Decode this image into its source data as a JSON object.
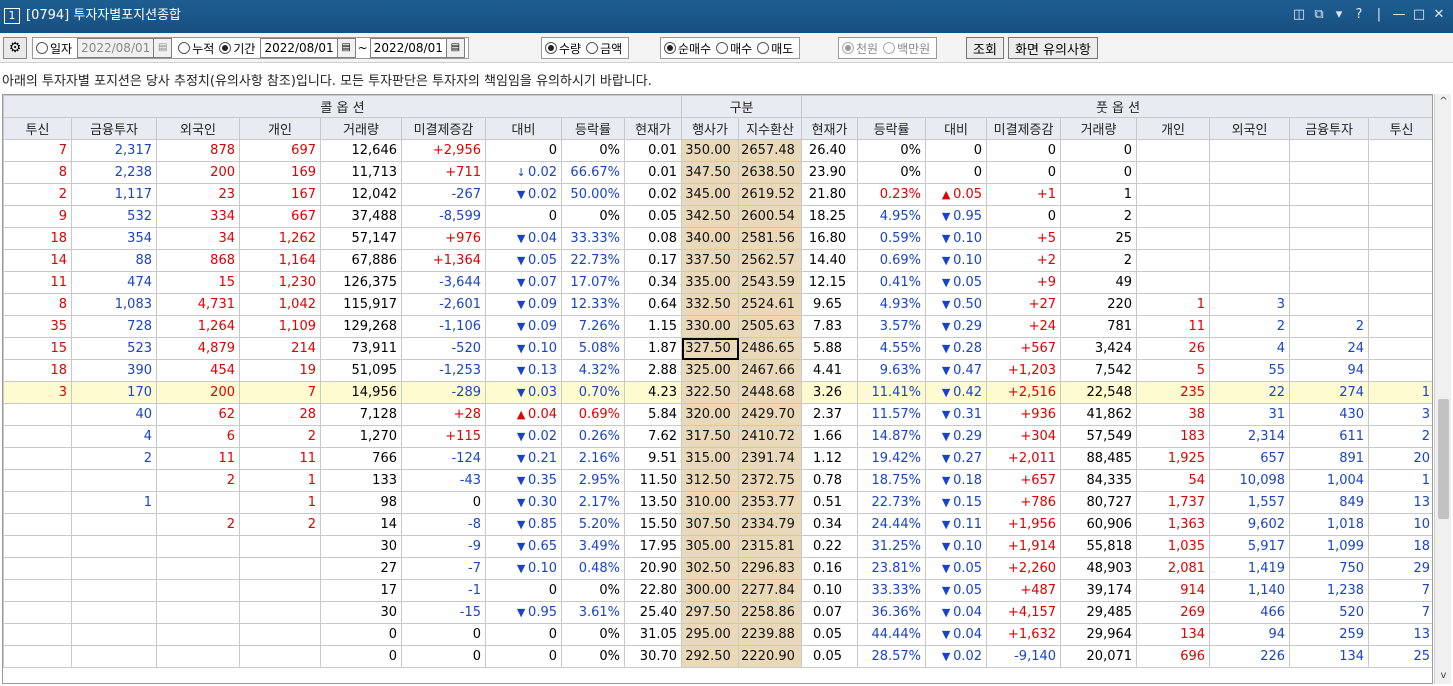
{
  "title": {
    "num": "1",
    "text": "[0794] 투자자별포지션종합",
    "controls": [
      "◫",
      "⧉",
      "▾",
      "?",
      "|",
      "—",
      "□",
      "✕"
    ]
  },
  "toolbar": {
    "gear": "⚙",
    "date_mode": {
      "daily": "일자",
      "cumulative": "누적",
      "period": "기간",
      "selected": "period"
    },
    "date_single": "2022/08/01",
    "date_from": "2022/08/01",
    "sep": "~",
    "date_to": "2022/08/01",
    "unit_type": {
      "qty": "수량",
      "amount": "금액",
      "selected": "qty"
    },
    "trade_type": {
      "net": "순매수",
      "buy": "매수",
      "sell": "매도",
      "selected": "net"
    },
    "money_unit": {
      "won": "천원",
      "mil": "백만원",
      "selected": "won"
    },
    "query_label": "조회",
    "notice_button": "화면 유의사항"
  },
  "notice": "아래의 투자자별 포지션은 당사 추정치(유의사항 참조)입니다. 모든 투자판단은 투자자의 책임임을 유의하시기 바랍니다.",
  "grid": {
    "group_headers": {
      "call": "콜 옵 션",
      "mid": "구분",
      "put": "풋 옵 션"
    },
    "columns": [
      "투신",
      "금융투자",
      "외국인",
      "개인",
      "거래량",
      "미결제증감",
      "대비",
      "등락률",
      "현재가",
      "행사가",
      "지수환산",
      "현재가",
      "등락률",
      "대비",
      "미결제증감",
      "거래량",
      "개인",
      "외국인",
      "금융투자",
      "투신"
    ],
    "rows": [
      {
        "c": [
          "7",
          "2,317",
          "878",
          "697",
          "12,646",
          "+2,956",
          "",
          "0",
          "0%",
          "0.01",
          "350.00",
          "2657.48",
          "26.40",
          "0%",
          "",
          "0",
          "0",
          "0",
          "",
          "",
          "",
          ""
        ]
      },
      {
        "c": [
          "8",
          "2,238",
          "200",
          "169",
          "11,713",
          "+711",
          "↓",
          "0.02",
          "66.67%",
          "0.01",
          "347.50",
          "2638.50",
          "23.90",
          "0%",
          "",
          "0",
          "0",
          "0",
          "",
          "",
          "",
          ""
        ]
      },
      {
        "c": [
          "2",
          "1,117",
          "23",
          "167",
          "12,042",
          "-267",
          "▼",
          "0.02",
          "50.00%",
          "0.02",
          "345.00",
          "2619.52",
          "21.80",
          "0.23%",
          "▲",
          "0.05",
          "+1",
          "1",
          "",
          "",
          "",
          ""
        ]
      },
      {
        "c": [
          "9",
          "532",
          "334",
          "667",
          "37,488",
          "-8,599",
          "",
          "0",
          "0%",
          "0.05",
          "342.50",
          "2600.54",
          "18.25",
          "4.95%",
          "▼",
          "0.95",
          "0",
          "2",
          "",
          "",
          "",
          ""
        ]
      },
      {
        "c": [
          "18",
          "354",
          "34",
          "1,262",
          "57,147",
          "+976",
          "▼",
          "0.04",
          "33.33%",
          "0.08",
          "340.00",
          "2581.56",
          "16.80",
          "0.59%",
          "▼",
          "0.10",
          "+5",
          "25",
          "",
          "",
          "",
          ""
        ]
      },
      {
        "c": [
          "14",
          "88",
          "868",
          "1,164",
          "67,886",
          "+1,364",
          "▼",
          "0.05",
          "22.73%",
          "0.17",
          "337.50",
          "2562.57",
          "14.40",
          "0.69%",
          "▼",
          "0.10",
          "+2",
          "2",
          "",
          "",
          "",
          ""
        ]
      },
      {
        "c": [
          "11",
          "474",
          "15",
          "1,230",
          "126,375",
          "-3,644",
          "▼",
          "0.07",
          "17.07%",
          "0.34",
          "335.00",
          "2543.59",
          "12.15",
          "0.41%",
          "▼",
          "0.05",
          "+9",
          "49",
          "",
          "",
          "",
          ""
        ]
      },
      {
        "c": [
          "8",
          "1,083",
          "4,731",
          "1,042",
          "115,917",
          "-2,601",
          "▼",
          "0.09",
          "12.33%",
          "0.64",
          "332.50",
          "2524.61",
          "9.65",
          "4.93%",
          "▼",
          "0.50",
          "+27",
          "220",
          "1",
          "3",
          "",
          ""
        ]
      },
      {
        "c": [
          "35",
          "728",
          "1,264",
          "1,109",
          "129,268",
          "-1,106",
          "▼",
          "0.09",
          "7.26%",
          "1.15",
          "330.00",
          "2505.63",
          "7.83",
          "3.57%",
          "▼",
          "0.29",
          "+24",
          "781",
          "11",
          "2",
          "2",
          ""
        ]
      },
      {
        "c": [
          "15",
          "523",
          "4,879",
          "214",
          "73,911",
          "-520",
          "▼",
          "0.10",
          "5.08%",
          "1.87",
          "327.50",
          "2486.65",
          "5.88",
          "4.55%",
          "▼",
          "0.28",
          "+567",
          "3,424",
          "26",
          "4",
          "24",
          ""
        ]
      },
      {
        "c": [
          "18",
          "390",
          "454",
          "19",
          "51,095",
          "-1,253",
          "▼",
          "0.13",
          "4.32%",
          "2.88",
          "325.00",
          "2467.66",
          "4.41",
          "9.63%",
          "▼",
          "0.47",
          "+1,203",
          "7,542",
          "5",
          "55",
          "94",
          ""
        ]
      },
      {
        "c": [
          "3",
          "170",
          "200",
          "7",
          "14,956",
          "-289",
          "▼",
          "0.03",
          "0.70%",
          "4.23",
          "322.50",
          "2448.68",
          "3.26",
          "11.41%",
          "▼",
          "0.42",
          "+2,516",
          "22,548",
          "235",
          "22",
          "274",
          "1"
        ]
      },
      {
        "c": [
          "",
          "40",
          "62",
          "28",
          "7,128",
          "+28",
          "▲",
          "0.04",
          "0.69%",
          "5.84",
          "320.00",
          "2429.70",
          "2.37",
          "11.57%",
          "▼",
          "0.31",
          "+936",
          "41,862",
          "38",
          "31",
          "430",
          "3"
        ]
      },
      {
        "c": [
          "",
          "4",
          "6",
          "2",
          "1,270",
          "+115",
          "▼",
          "0.02",
          "0.26%",
          "7.62",
          "317.50",
          "2410.72",
          "1.66",
          "14.87%",
          "▼",
          "0.29",
          "+304",
          "57,549",
          "183",
          "2,314",
          "611",
          "2"
        ]
      },
      {
        "c": [
          "",
          "2",
          "11",
          "11",
          "766",
          "-124",
          "▼",
          "0.21",
          "2.16%",
          "9.51",
          "315.00",
          "2391.74",
          "1.12",
          "19.42%",
          "▼",
          "0.27",
          "+2,011",
          "88,485",
          "1,925",
          "657",
          "891",
          "20"
        ]
      },
      {
        "c": [
          "",
          "",
          "2",
          "1",
          "133",
          "-43",
          "▼",
          "0.35",
          "2.95%",
          "11.50",
          "312.50",
          "2372.75",
          "0.78",
          "18.75%",
          "▼",
          "0.18",
          "+657",
          "84,335",
          "54",
          "10,098",
          "1,004",
          "1"
        ]
      },
      {
        "c": [
          "",
          "1",
          "",
          "1",
          "98",
          "0",
          "▼",
          "0.30",
          "2.17%",
          "13.50",
          "310.00",
          "2353.77",
          "0.51",
          "22.73%",
          "▼",
          "0.15",
          "+786",
          "80,727",
          "1,737",
          "1,557",
          "849",
          "13"
        ]
      },
      {
        "c": [
          "",
          "",
          "2",
          "2",
          "14",
          "-8",
          "▼",
          "0.85",
          "5.20%",
          "15.50",
          "307.50",
          "2334.79",
          "0.34",
          "24.44%",
          "▼",
          "0.11",
          "+1,956",
          "60,906",
          "1,363",
          "9,602",
          "1,018",
          "10"
        ]
      },
      {
        "c": [
          "",
          "",
          "",
          "",
          "30",
          "-9",
          "▼",
          "0.65",
          "3.49%",
          "17.95",
          "305.00",
          "2315.81",
          "0.22",
          "31.25%",
          "▼",
          "0.10",
          "+1,914",
          "55,818",
          "1,035",
          "5,917",
          "1,099",
          "18"
        ]
      },
      {
        "c": [
          "",
          "",
          "",
          "",
          "27",
          "-7",
          "▼",
          "0.10",
          "0.48%",
          "20.90",
          "302.50",
          "2296.83",
          "0.16",
          "23.81%",
          "▼",
          "0.05",
          "+2,260",
          "48,903",
          "2,081",
          "1,419",
          "750",
          "29"
        ]
      },
      {
        "c": [
          "",
          "",
          "",
          "",
          "17",
          "-1",
          "",
          "0",
          "0%",
          "22.80",
          "300.00",
          "2277.84",
          "0.10",
          "33.33%",
          "▼",
          "0.05",
          "+487",
          "39,174",
          "914",
          "1,140",
          "1,238",
          "7"
        ]
      },
      {
        "c": [
          "",
          "",
          "",
          "",
          "30",
          "-15",
          "▼",
          "0.95",
          "3.61%",
          "25.40",
          "297.50",
          "2258.86",
          "0.07",
          "36.36%",
          "▼",
          "0.04",
          "+4,157",
          "29,485",
          "269",
          "466",
          "520",
          "7"
        ]
      },
      {
        "c": [
          "",
          "",
          "",
          "",
          "0",
          "0",
          "",
          "0",
          "0%",
          "31.05",
          "295.00",
          "2239.88",
          "0.05",
          "44.44%",
          "▼",
          "0.04",
          "+1,632",
          "29,964",
          "134",
          "94",
          "259",
          "13"
        ]
      },
      {
        "c": [
          "",
          "",
          "",
          "",
          "0",
          "0",
          "",
          "0",
          "0%",
          "30.70",
          "292.50",
          "2220.90",
          "0.05",
          "28.57%",
          "▼",
          "0.02",
          "-9,140",
          "20,071",
          "696",
          "226",
          "134",
          "25"
        ]
      }
    ],
    "highlight_row": 11,
    "selected_strike_row": 9
  },
  "colors": {
    "title_bg": "#17507f",
    "mid_bg": "#ead9b9",
    "highlight": "#fffbd0",
    "up": "#e00000",
    "down": "#1a44c8"
  },
  "scroll": {
    "up": "^",
    "down": "v"
  }
}
